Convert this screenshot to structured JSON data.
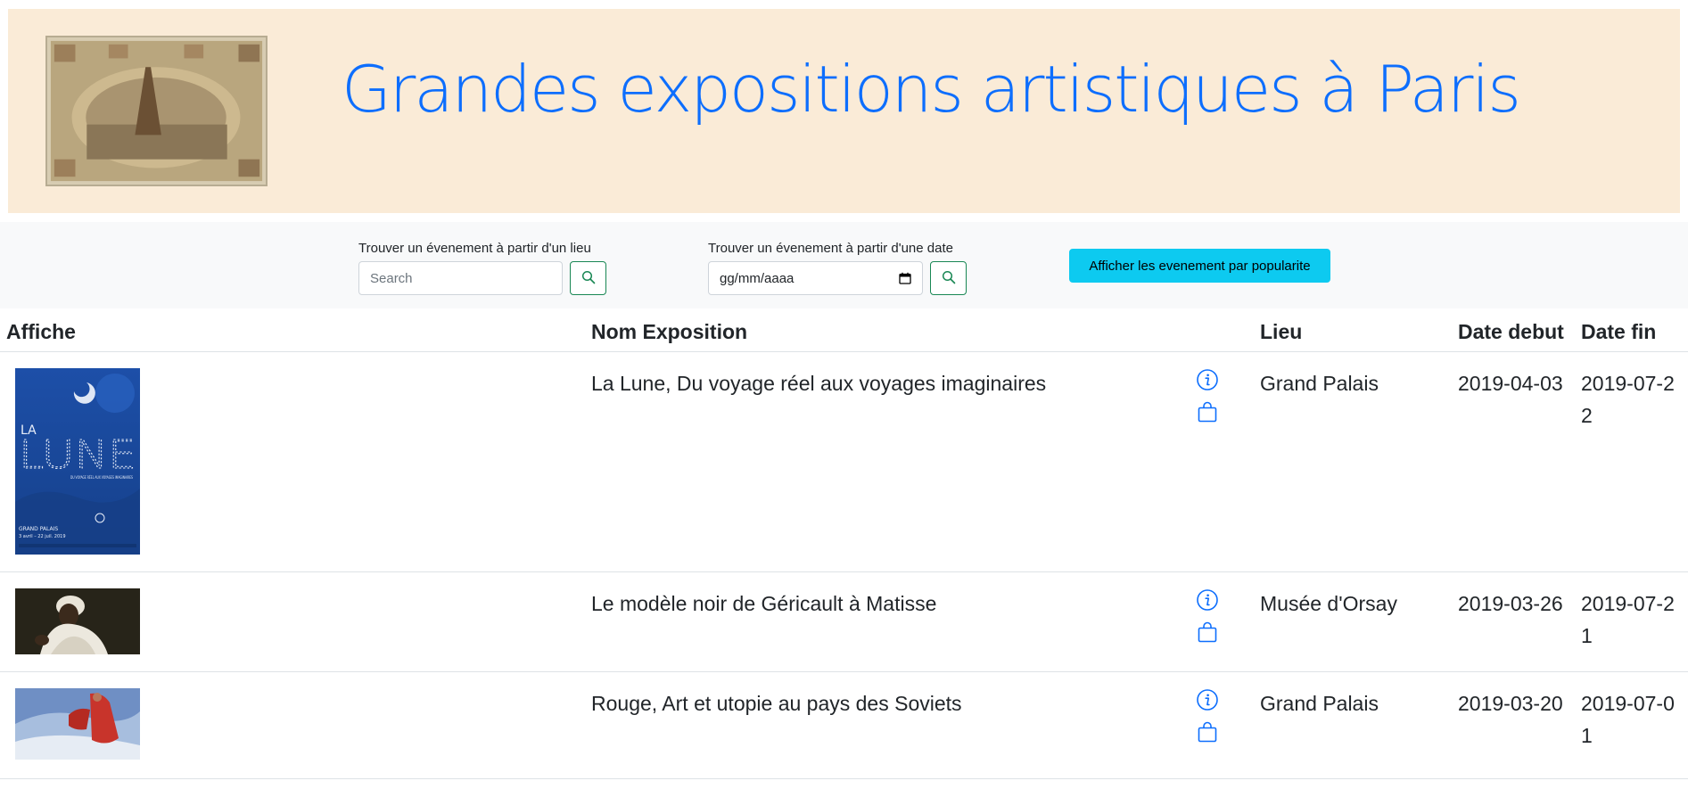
{
  "header": {
    "title": "Grandes expositions artistiques à Paris",
    "banner_image": "eiffel-tower-exposition-poster"
  },
  "search": {
    "place": {
      "label": "Trouver un évenement à partir d'un lieu",
      "placeholder": "Search",
      "button_icon": "search-icon"
    },
    "date": {
      "label": "Trouver un évenement à partir d'une date",
      "placeholder": "gg/mm/aaaa",
      "button_icon": "search-icon"
    },
    "popularity_button": "Afficher les evenement par popularite"
  },
  "table": {
    "headers": {
      "poster": "Affiche",
      "name": "Nom Exposition",
      "actions": "",
      "place": "Lieu",
      "start": "Date debut",
      "end": "Date fin"
    },
    "rows": [
      {
        "poster": "la-lune-poster",
        "name": "La Lune, Du voyage réel aux voyages imaginaires",
        "place": "Grand Palais",
        "start": "2019-04-03",
        "end": "2019-07-22",
        "poster_text": [
          "LA",
          "LUNE",
          "DU VOYAGE RÉEL AUX VOYAGES IMAGINAIRES",
          "GRAND PALAIS",
          "3 avril – 22 juil. 2019"
        ]
      },
      {
        "poster": "modele-noir-poster",
        "name": "Le modèle noir de Géricault à Matisse",
        "place": "Musée d'Orsay",
        "start": "2019-03-26",
        "end": "2019-07-21"
      },
      {
        "poster": "rouge-poster",
        "name": "Rouge, Art et utopie au pays des Soviets",
        "place": "Grand Palais",
        "start": "2019-03-20",
        "end": "2019-07-01"
      }
    ]
  },
  "colors": {
    "banner_bg": "#faebd7",
    "title": "#0d6efd",
    "toolbar_bg": "#f8f9fa",
    "search_border": "#198754",
    "popularity_button": "#0dcaf0",
    "action_icon": "#0d6efd"
  },
  "icons": {
    "info": "info-circle-icon",
    "shop": "shopping-bag-icon",
    "calendar": "calendar-icon"
  }
}
